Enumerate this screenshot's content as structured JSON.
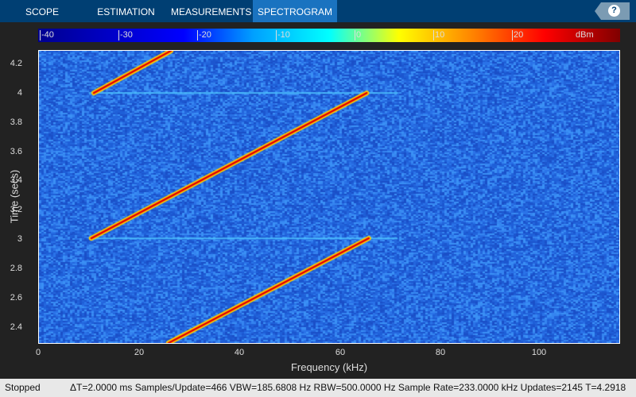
{
  "tabs": [
    {
      "label": "SCOPE"
    },
    {
      "label": "ESTIMATION"
    },
    {
      "label": "MEASUREMENTS"
    },
    {
      "label": "SPECTROGRAM",
      "active": true
    }
  ],
  "help_label": "?",
  "colorbar": {
    "ticks": [
      "-40",
      "-30",
      "-20",
      "-10",
      "0",
      "10",
      "20"
    ],
    "unit": "dBm"
  },
  "axes": {
    "xlabel": "Frequency (kHz)",
    "ylabel": "Time (secs)",
    "xticks": [
      "0",
      "20",
      "40",
      "60",
      "80",
      "100"
    ],
    "yticks": [
      "4.2",
      "4",
      "3.8",
      "3.6",
      "3.4",
      "3.2",
      "3",
      "2.8",
      "2.6",
      "2.4"
    ],
    "xlim": [
      0,
      116.5
    ],
    "ylim": [
      2.29,
      4.3
    ]
  },
  "chirps": [
    {
      "f0": 11,
      "t0": 4.01,
      "f1": 26.5,
      "t1": 4.3
    },
    {
      "f0": 10.5,
      "t0": 3.01,
      "f1": 65.8,
      "t1": 4.01
    },
    {
      "f0": 26,
      "t0": 2.29,
      "f1": 66.2,
      "t1": 3.01
    }
  ],
  "status": {
    "state": "Stopped",
    "info": "ΔT=2.0000 ms  Samples/Update=466  VBW=185.6808 Hz  RBW=500.0000 Hz  Sample Rate=233.0000 kHz  Updates=2145  T=4.2918"
  }
}
